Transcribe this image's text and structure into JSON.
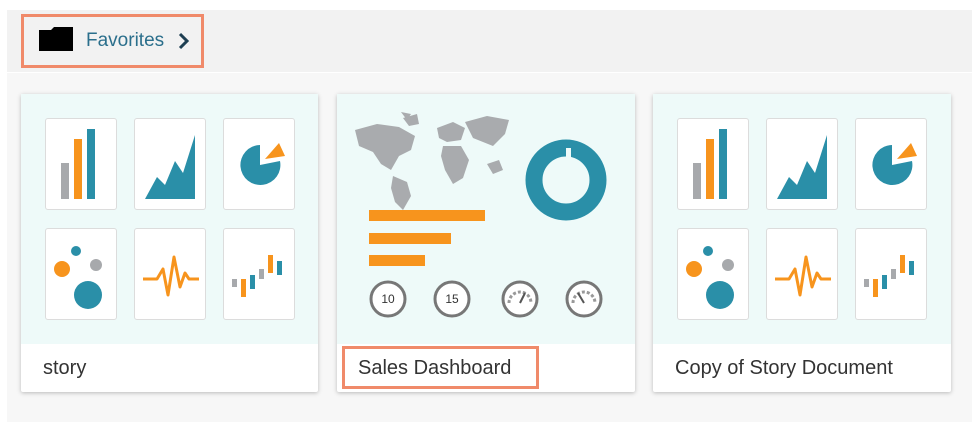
{
  "breadcrumb": {
    "label": "Favorites",
    "folder_icon": "folder-icon",
    "chevron_icon": "chevron-right-icon"
  },
  "cards": [
    {
      "title": "story",
      "thumbnail": "story-icons-grid"
    },
    {
      "title": "Sales Dashboard",
      "thumbnail": "dashboard-preview",
      "gauges": [
        "10",
        "15"
      ]
    },
    {
      "title": "Copy of Story Document",
      "thumbnail": "story-icons-grid"
    }
  ],
  "colors": {
    "teal": "#2a8fa8",
    "orange": "#f7941d",
    "gray": "#a7a9ac",
    "highlight": "#f08a6a",
    "link": "#2b6f8c"
  }
}
